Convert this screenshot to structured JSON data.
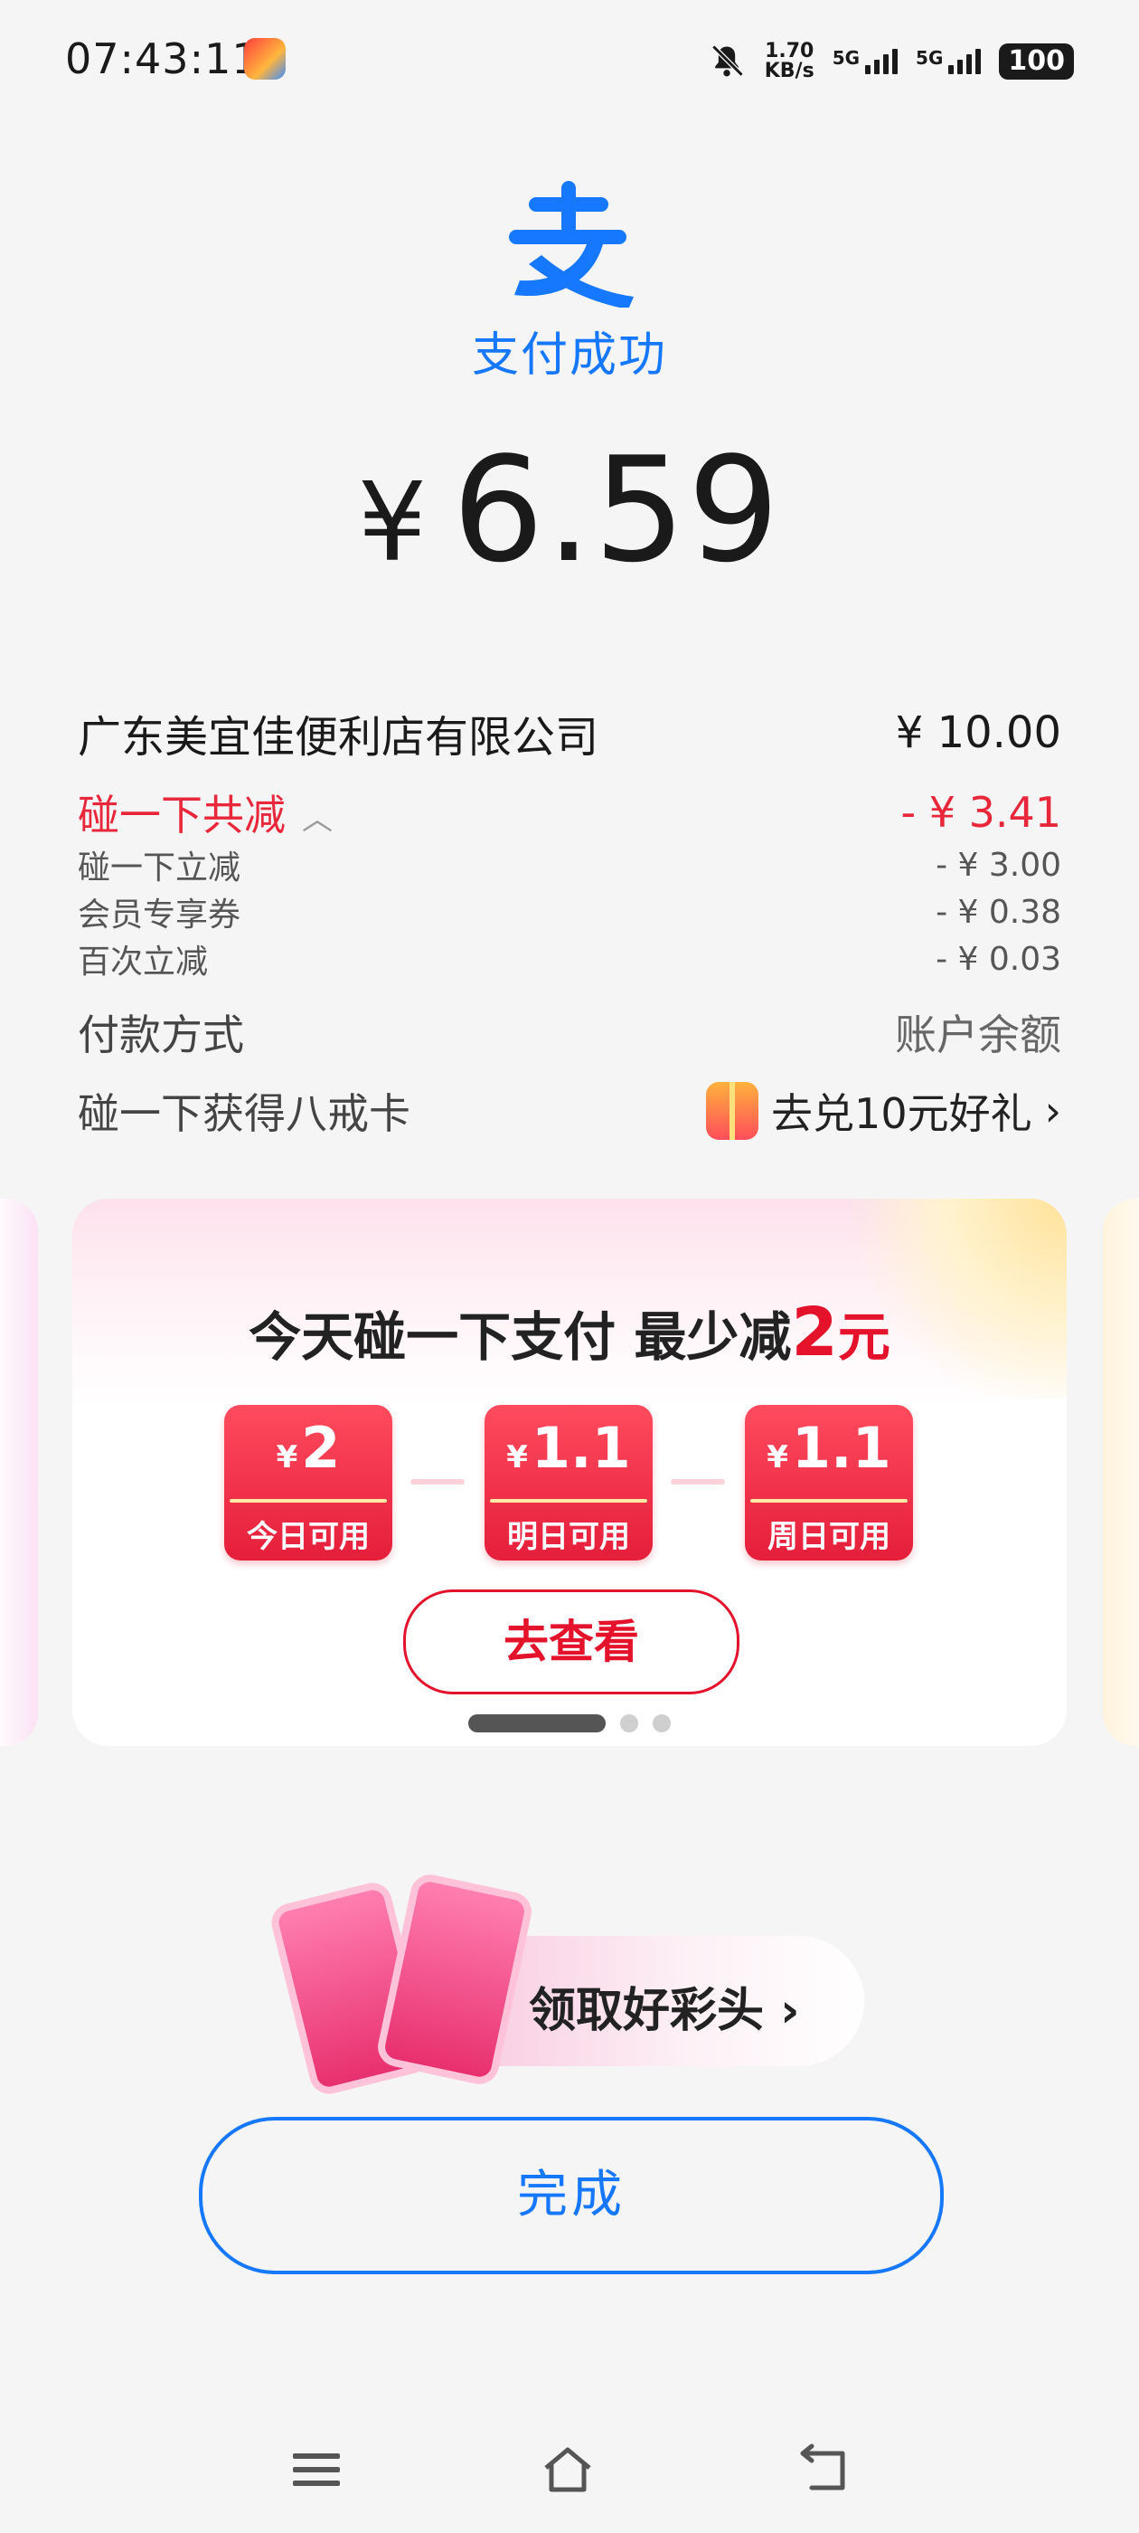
{
  "status_bar": {
    "time": "07:43:11",
    "net_speed_value": "1.70",
    "net_speed_unit": "KB/s",
    "sim1": "5G",
    "sim2": "5G",
    "battery": "100"
  },
  "header": {
    "logo_icon": "alipay-logo-icon",
    "title": "支付成功"
  },
  "amount": {
    "currency": "¥",
    "value": "6.59"
  },
  "details": {
    "merchant": "广东美宜佳便利店有限公司",
    "merchant_amount": "¥ 10.00",
    "discount_label": "碰一下共减",
    "discount_total": "- ¥ 3.41",
    "discounts": [
      {
        "label": "碰一下立减",
        "value": "- ¥ 3.00"
      },
      {
        "label": "会员专享券",
        "value": "- ¥ 0.38"
      },
      {
        "label": "百次立减",
        "value": "- ¥ 0.03"
      }
    ],
    "payment_label": "付款方式",
    "payment_value": "账户余额",
    "card_label": "碰一下获得八戒卡",
    "card_link": "去兑10元好礼"
  },
  "promo": {
    "title_prefix": "今天碰一下支付 最少减",
    "title_amount": "2",
    "title_unit": "元",
    "coupons": [
      {
        "currency": "¥",
        "value": "2",
        "label": "今日可用"
      },
      {
        "currency": "¥",
        "value": "1.1",
        "label": "明日可用"
      },
      {
        "currency": "¥",
        "value": "1.1",
        "label": "周日可用"
      }
    ],
    "button": "去查看",
    "page_index": 1,
    "page_count": 3
  },
  "luck": {
    "label": "领取好彩头"
  },
  "done_button": "完成",
  "colors": {
    "primary": "#1677ff",
    "discount": "#e8283a",
    "promo_red": "#e4132b"
  }
}
